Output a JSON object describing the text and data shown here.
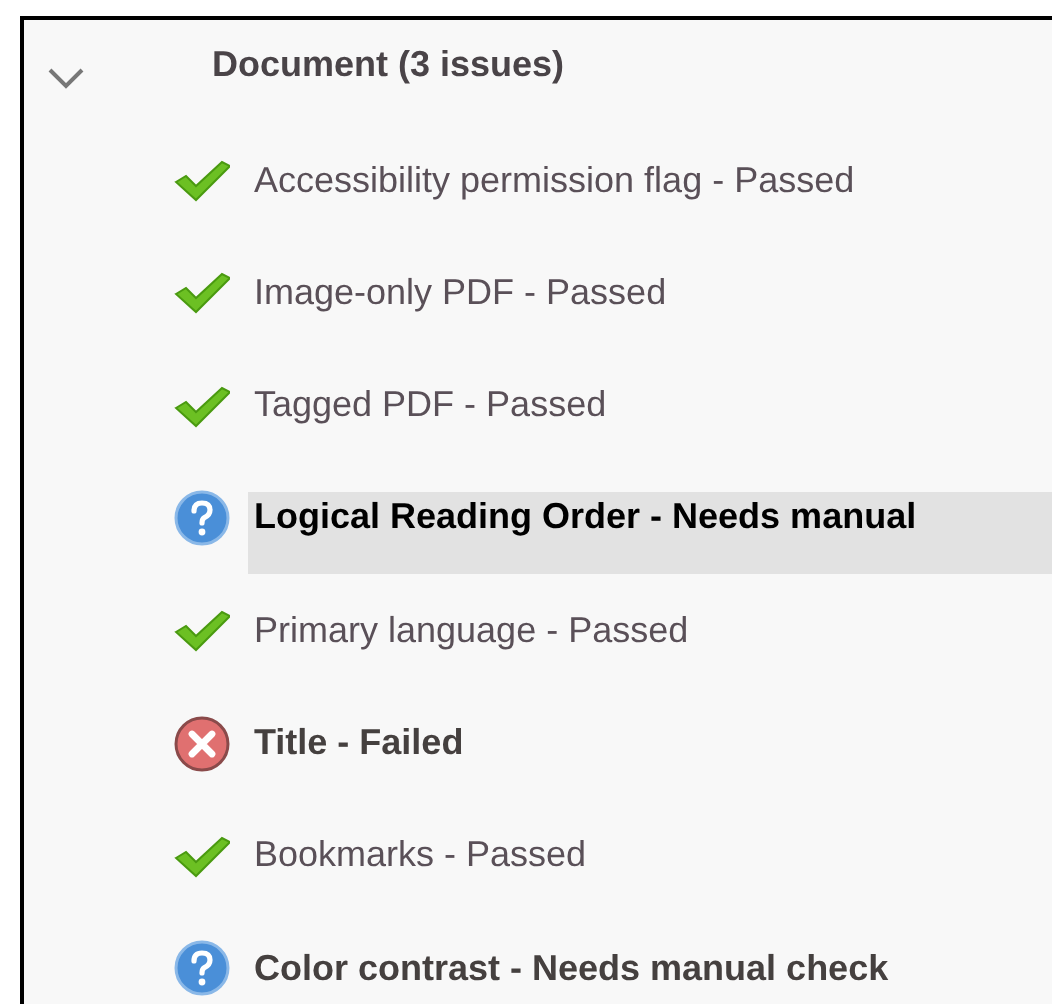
{
  "section": {
    "title": "Document (3 issues)",
    "expanded": true,
    "items": [
      {
        "label": "Accessibility permission flag - Passed",
        "kind": "passed",
        "selected": false
      },
      {
        "label": "Image-only PDF - Passed",
        "kind": "passed",
        "selected": false
      },
      {
        "label": "Tagged PDF - Passed",
        "kind": "passed",
        "selected": false
      },
      {
        "label": "Logical Reading Order - Needs manual",
        "kind": "manual",
        "selected": true
      },
      {
        "label": "Primary language - Passed",
        "kind": "passed",
        "selected": false
      },
      {
        "label": "Title - Failed",
        "kind": "failed",
        "selected": false
      },
      {
        "label": "Bookmarks - Passed",
        "kind": "passed",
        "selected": false
      },
      {
        "label": "Color contrast - Needs manual check",
        "kind": "manual",
        "selected": false
      }
    ]
  }
}
